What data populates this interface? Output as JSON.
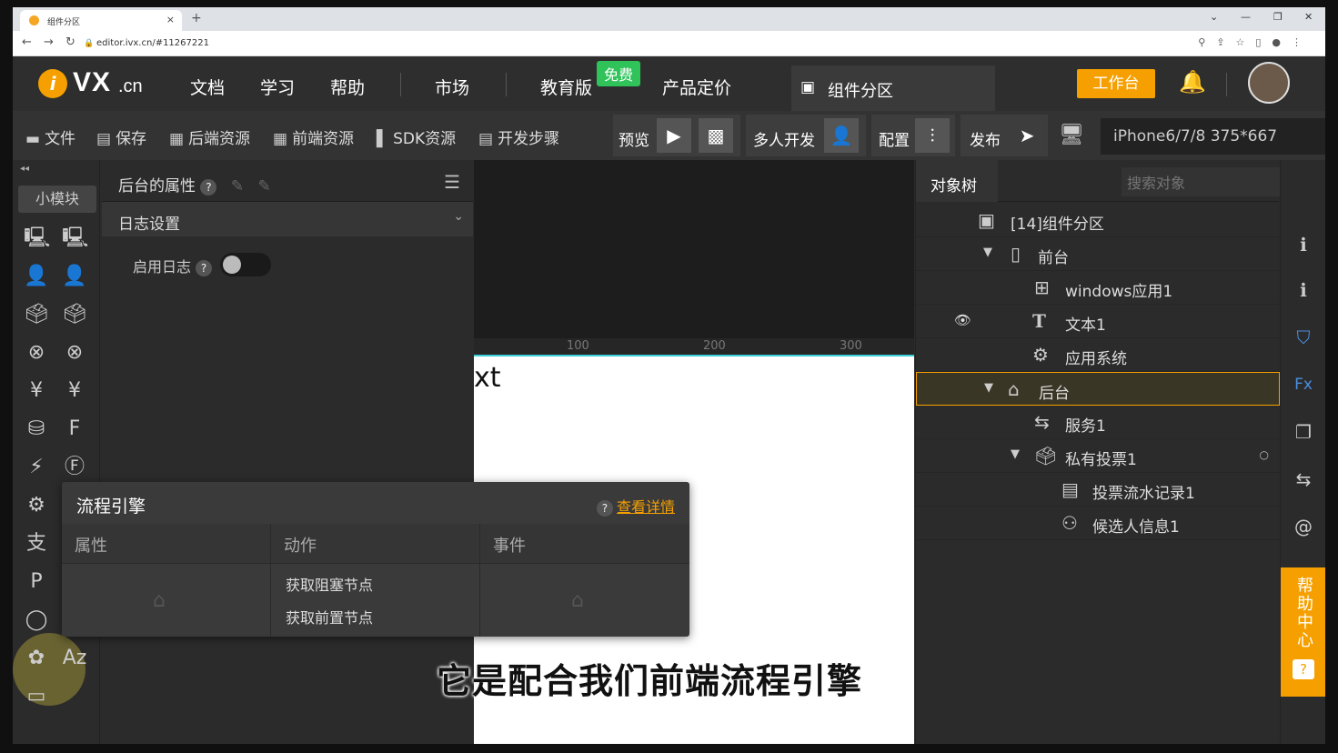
{
  "browser": {
    "tab_title": "组件分区",
    "tab_close": "×",
    "new_tab": "+",
    "url": "editor.ivx.cn/#11267221"
  },
  "header": {
    "logo_i": "i",
    "logo_vx": "VX",
    "logo_cn": ".cn",
    "nav": [
      "文档",
      "学习",
      "帮助",
      "市场",
      "教育版",
      "产品定价"
    ],
    "free_badge": "免费",
    "active_tab": "组件分区",
    "workbench": "工作台"
  },
  "toolbar": {
    "file": "文件",
    "save": "保存",
    "backend_res": "后端资源",
    "frontend_res": "前端资源",
    "sdk_res": "SDK资源",
    "dev_steps": "开发步骤",
    "preview": "预览",
    "multi_dev": "多人开发",
    "config": "配置",
    "publish": "发布",
    "device": "iPhone6/7/8 375*667"
  },
  "left_rail": {
    "small_module": "小模块"
  },
  "properties": {
    "title": "后台的属性",
    "section": "日志设置",
    "enable_log": "启用日志",
    "help": "?",
    "enable_log_on": false
  },
  "canvas": {
    "ruler": [
      "100",
      "200",
      "300"
    ],
    "page_text": "xt"
  },
  "subtitle": "它是配合我们前端流程引擎",
  "popup": {
    "title": "流程引擎",
    "details_link": "查看详情",
    "columns": [
      "属性",
      "动作",
      "事件"
    ],
    "actions": [
      "获取阻塞节点",
      "获取前置节点"
    ]
  },
  "tree": {
    "tab": "对象树",
    "search_placeholder": "搜索对象",
    "nodes": [
      {
        "label": "[14]组件分区"
      },
      {
        "label": "前台"
      },
      {
        "label": "windows应用1"
      },
      {
        "label": "文本1"
      },
      {
        "label": "应用系统"
      },
      {
        "label": "后台"
      },
      {
        "label": "服务1"
      },
      {
        "label": "私有投票1"
      },
      {
        "label": "投票流水记录1"
      },
      {
        "label": "候选人信息1"
      }
    ]
  },
  "help_center": "帮助中心",
  "colors": {
    "accent": "#f5a000",
    "free": "#2fc35a",
    "selection_border": "#f5a000"
  }
}
